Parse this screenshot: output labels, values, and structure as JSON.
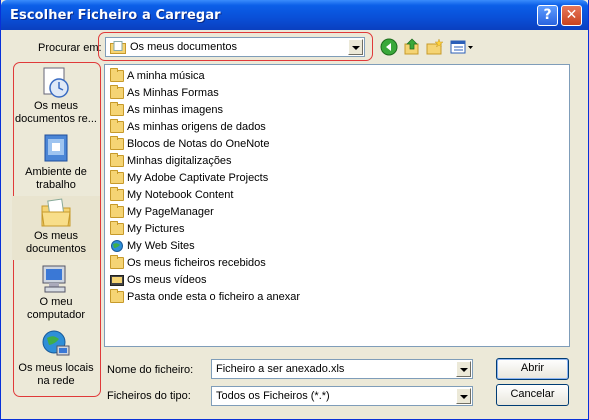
{
  "window": {
    "title": "Escolher Ficheiro a Carregar"
  },
  "titlebar_buttons": {
    "help": "?",
    "close": "✕"
  },
  "lookin": {
    "label": "Procurar em:",
    "value": "Os meus documentos"
  },
  "toolbar": {
    "icons": [
      "back-icon",
      "up-folder-icon",
      "new-folder-icon",
      "views-menu-icon"
    ]
  },
  "places": [
    {
      "label_line1": "Os meus",
      "label_line2": "documentos re...",
      "icon": "recent-documents-icon"
    },
    {
      "label_line1": "Ambiente de",
      "label_line2": "trabalho",
      "icon": "desktop-icon"
    },
    {
      "label_line1": "Os meus",
      "label_line2": "documentos",
      "icon": "my-documents-icon"
    },
    {
      "label_line1": "O meu",
      "label_line2": "computador",
      "icon": "my-computer-icon"
    },
    {
      "label_line1": "Os meus locais",
      "label_line2": "na rede",
      "icon": "network-places-icon"
    }
  ],
  "files": [
    {
      "name": "A minha música",
      "icon": "music-folder-icon"
    },
    {
      "name": "As Minhas Formas",
      "icon": "shapes-folder-icon"
    },
    {
      "name": "As minhas imagens",
      "icon": "pictures-folder-icon"
    },
    {
      "name": "As minhas origens de dados",
      "icon": "data-sources-folder-icon"
    },
    {
      "name": "Blocos de Notas do OneNote",
      "icon": "folder-icon"
    },
    {
      "name": "Minhas digitalizações",
      "icon": "folder-icon"
    },
    {
      "name": "My Adobe Captivate Projects",
      "icon": "folder-icon"
    },
    {
      "name": "My Notebook Content",
      "icon": "folder-icon"
    },
    {
      "name": "My PageManager",
      "icon": "folder-icon"
    },
    {
      "name": "My Pictures",
      "icon": "folder-icon"
    },
    {
      "name": "My Web Sites",
      "icon": "web-sites-folder-icon"
    },
    {
      "name": "Os meus ficheiros recebidos",
      "icon": "folder-icon"
    },
    {
      "name": "Os meus vídeos",
      "icon": "videos-folder-icon"
    },
    {
      "name": "Pasta onde esta o ficheiro a anexar",
      "icon": "folder-icon"
    }
  ],
  "filename": {
    "label": "Nome do ficheiro:",
    "value": "Ficheiro a ser anexado.xls"
  },
  "filetype": {
    "label": "Ficheiros do tipo:",
    "value": "Todos os Ficheiros (*.*)"
  },
  "buttons": {
    "open": "Abrir",
    "cancel": "Cancelar"
  },
  "colors": {
    "title_bar": "#0a4fd7",
    "dialog_bg": "#ece9d8",
    "highlight_box": "#e03a3a"
  }
}
